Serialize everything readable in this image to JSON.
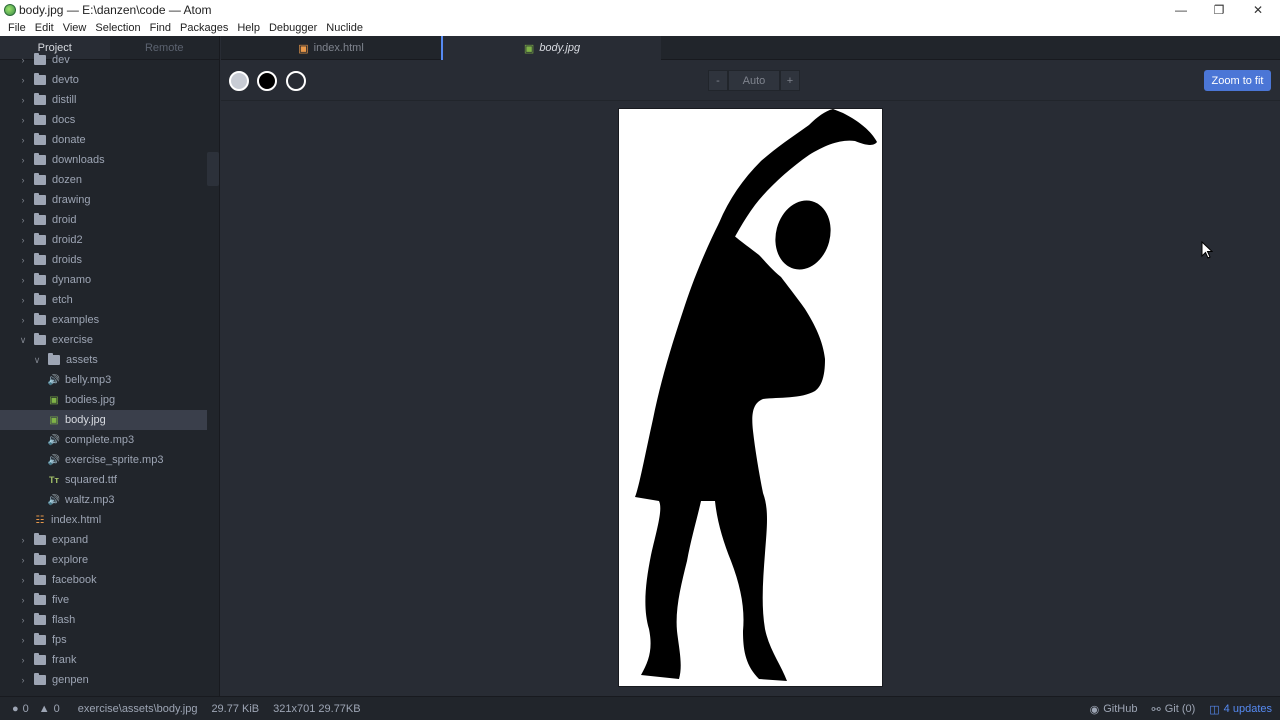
{
  "window": {
    "title": "body.jpg — E:\\danzen\\code — Atom",
    "controls": {
      "minimize": "—",
      "restore": "❐",
      "close": "✕"
    }
  },
  "menu": [
    "File",
    "Edit",
    "View",
    "Selection",
    "Find",
    "Packages",
    "Help",
    "Debugger",
    "Nuclide"
  ],
  "treeview": {
    "tabs": {
      "project": "Project",
      "remote": "Remote"
    },
    "rows": [
      {
        "name": "dev",
        "kind": "folder",
        "depth": 0,
        "expanded": false
      },
      {
        "name": "devto",
        "kind": "folder",
        "depth": 0,
        "expanded": false
      },
      {
        "name": "distill",
        "kind": "folder",
        "depth": 0,
        "expanded": false
      },
      {
        "name": "docs",
        "kind": "folder",
        "depth": 0,
        "expanded": false
      },
      {
        "name": "donate",
        "kind": "folder",
        "depth": 0,
        "expanded": false
      },
      {
        "name": "downloads",
        "kind": "folder",
        "depth": 0,
        "expanded": false
      },
      {
        "name": "dozen",
        "kind": "folder",
        "depth": 0,
        "expanded": false
      },
      {
        "name": "drawing",
        "kind": "folder",
        "depth": 0,
        "expanded": false
      },
      {
        "name": "droid",
        "kind": "folder",
        "depth": 0,
        "expanded": false
      },
      {
        "name": "droid2",
        "kind": "folder",
        "depth": 0,
        "expanded": false
      },
      {
        "name": "droids",
        "kind": "folder",
        "depth": 0,
        "expanded": false
      },
      {
        "name": "dynamo",
        "kind": "folder",
        "depth": 0,
        "expanded": false
      },
      {
        "name": "etch",
        "kind": "folder",
        "depth": 0,
        "expanded": false
      },
      {
        "name": "examples",
        "kind": "folder",
        "depth": 0,
        "expanded": false
      },
      {
        "name": "exercise",
        "kind": "folder",
        "depth": 0,
        "expanded": true
      },
      {
        "name": "assets",
        "kind": "folder",
        "depth": 1,
        "expanded": true
      },
      {
        "name": "belly.mp3",
        "kind": "audio",
        "depth": 2
      },
      {
        "name": "bodies.jpg",
        "kind": "image",
        "depth": 2
      },
      {
        "name": "body.jpg",
        "kind": "image",
        "depth": 2,
        "selected": true
      },
      {
        "name": "complete.mp3",
        "kind": "audio",
        "depth": 2
      },
      {
        "name": "exercise_sprite.mp3",
        "kind": "audio",
        "depth": 2
      },
      {
        "name": "squared.ttf",
        "kind": "font",
        "depth": 2
      },
      {
        "name": "waltz.mp3",
        "kind": "audio",
        "depth": 2
      },
      {
        "name": "index.html",
        "kind": "html",
        "depth": 1
      },
      {
        "name": "expand",
        "kind": "folder",
        "depth": 0,
        "expanded": false
      },
      {
        "name": "explore",
        "kind": "folder",
        "depth": 0,
        "expanded": false
      },
      {
        "name": "facebook",
        "kind": "folder",
        "depth": 0,
        "expanded": false
      },
      {
        "name": "five",
        "kind": "folder",
        "depth": 0,
        "expanded": false
      },
      {
        "name": "flash",
        "kind": "folder",
        "depth": 0,
        "expanded": false
      },
      {
        "name": "fps",
        "kind": "folder",
        "depth": 0,
        "expanded": false
      },
      {
        "name": "frank",
        "kind": "folder",
        "depth": 0,
        "expanded": false
      },
      {
        "name": "genpen",
        "kind": "folder",
        "depth": 0,
        "expanded": false
      }
    ]
  },
  "tabs": [
    {
      "label": "index.html",
      "icon": "html-file-icon",
      "active": false
    },
    {
      "label": "body.jpg",
      "icon": "image-file-icon",
      "active": true
    }
  ],
  "imageview": {
    "zoom": {
      "minus": "-",
      "level": "Auto",
      "plus": "+"
    },
    "zoom_to_fit": "Zoom to fit",
    "background_swatches": [
      "transparent-background-swatch",
      "black-background-swatch",
      "white-background-swatch"
    ]
  },
  "statusbar": {
    "errors": "0",
    "warnings": "0",
    "path": "exercise\\assets\\body.jpg",
    "file_size": "29.77 KiB",
    "dimensions": "321x701 29.77KB",
    "github": "GitHub",
    "git": "Git (0)",
    "updates": "4 updates"
  },
  "colors": {
    "accent": "#568af2",
    "fit_button": "#4b76d6",
    "background": "#282c34",
    "panel": "#21252b"
  }
}
